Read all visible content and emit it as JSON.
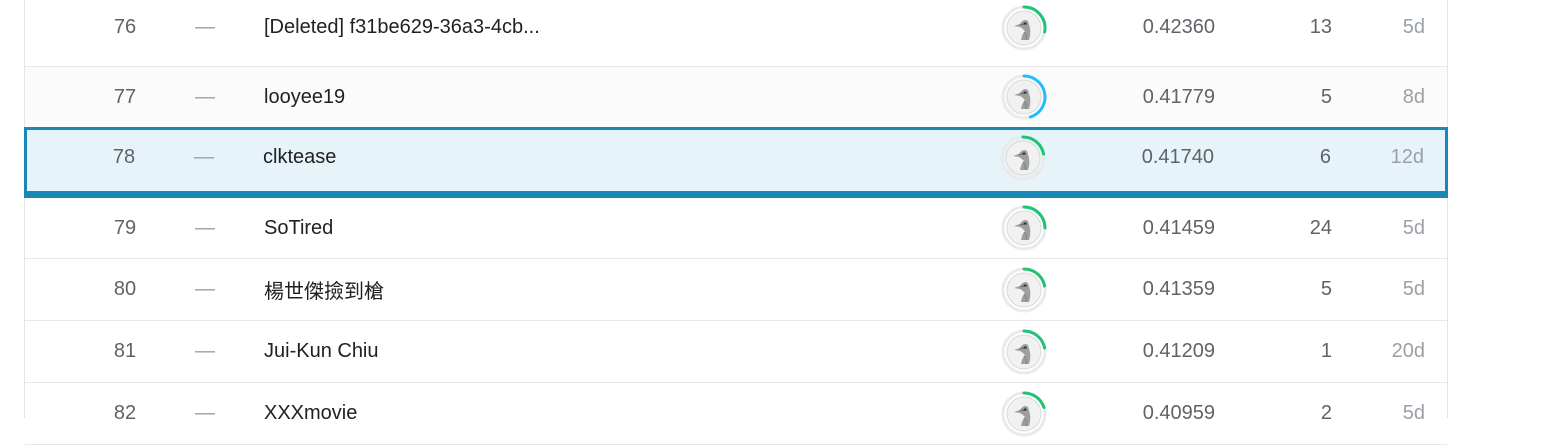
{
  "leaderboard": {
    "rows": [
      {
        "rank": "76",
        "delta": "—",
        "team": "[Deleted] f31be629-36a3-4cb...",
        "score": "0.42360",
        "entries": "13",
        "last": "5d",
        "tier_color": "#20beff",
        "progress_color": "#20c374"
      },
      {
        "rank": "77",
        "delta": "—",
        "team": "looyee19",
        "score": "0.41779",
        "entries": "5",
        "last": "8d",
        "tier_color": "#20beff",
        "progress_color": "#20beff"
      },
      {
        "rank": "78",
        "delta": "—",
        "team": "clktease",
        "score": "0.41740",
        "entries": "6",
        "last": "12d",
        "tier_color": "#20c374",
        "progress_color": "#20c374"
      },
      {
        "rank": "79",
        "delta": "—",
        "team": "SoTired",
        "score": "0.41459",
        "entries": "24",
        "last": "5d",
        "tier_color": "#20c374",
        "progress_color": "#20c374"
      },
      {
        "rank": "80",
        "delta": "—",
        "team": "楊世傑撿到槍",
        "score": "0.41359",
        "entries": "5",
        "last": "5d",
        "tier_color": "#20c374",
        "progress_color": "#20c374"
      },
      {
        "rank": "81",
        "delta": "—",
        "team": "Jui-Kun Chiu",
        "score": "0.41209",
        "entries": "1",
        "last": "20d",
        "tier_color": "#20c374",
        "progress_color": "#20c374"
      },
      {
        "rank": "82",
        "delta": "—",
        "team": "XXXmovie",
        "score": "0.40959",
        "entries": "2",
        "last": "5d",
        "tier_color": "#20c374",
        "progress_color": "#20c374"
      }
    ],
    "selected_index": 2,
    "colors": {
      "selected_border": "#1a87b4",
      "selected_background": "#e6f4f9"
    }
  },
  "icons": {
    "avatar": "goose-avatar-icon"
  }
}
